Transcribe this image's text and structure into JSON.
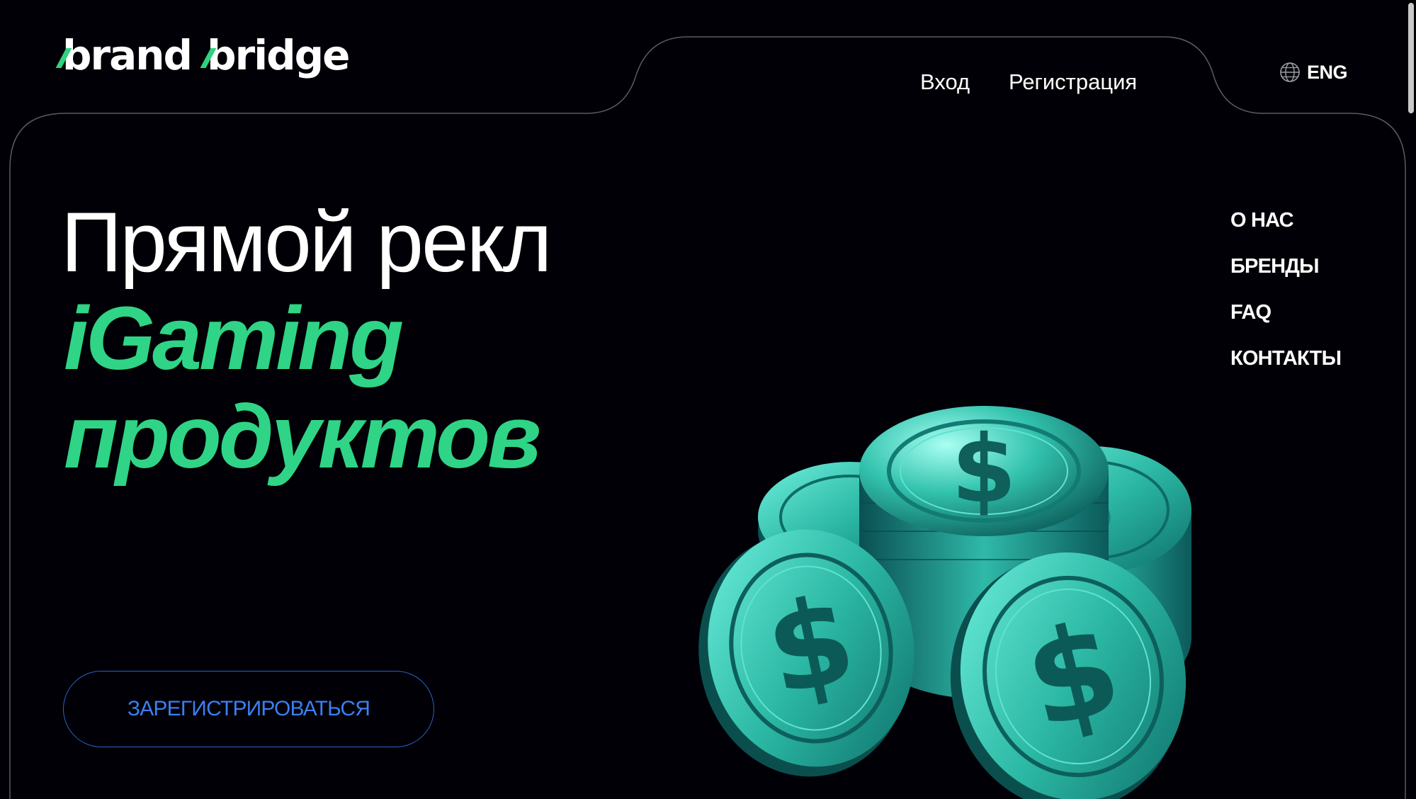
{
  "header": {
    "logo": {
      "word1": "brand",
      "word2": "bridge"
    },
    "nav": {
      "login": "Вход",
      "register": "Регистрация"
    },
    "language": {
      "label": "ENG",
      "icon": "globe-icon"
    }
  },
  "side_menu": {
    "items": [
      {
        "label": "О НАС"
      },
      {
        "label": "БРЕНДЫ"
      },
      {
        "label": "FAQ"
      },
      {
        "label": "КОНТАКТЫ"
      }
    ]
  },
  "hero": {
    "line1": "Прямой рекл",
    "line2": "iGaming",
    "line3": "продуктов",
    "cta_label": "ЗАРЕГИСТРИРОВАТЬСЯ",
    "image": {
      "icon": "dollar-coins-image",
      "coin_symbol": "$"
    }
  },
  "colors": {
    "background": "#000006",
    "accent_green": "#2fd486",
    "cta_blue": "#3b7ff2",
    "frame_line": "#5a5a66"
  }
}
